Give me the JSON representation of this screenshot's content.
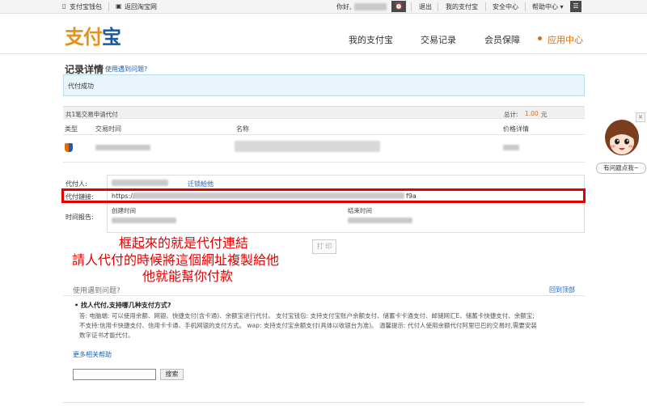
{
  "topbar": {
    "wallet": "支付宝钱包",
    "back_taobao": "返回淘宝网",
    "greeting": "你好,",
    "logout": "退出",
    "my_alipay": "我的支付宝",
    "security": "安全中心",
    "help_center": "帮助中心 ▾"
  },
  "header": {
    "logo_part1": "支付",
    "logo_part2": "宝",
    "nav": [
      "我的支付宝",
      "交易记录",
      "会员保障",
      "应用中心"
    ]
  },
  "page": {
    "title": "记录详情",
    "help_link": "使用遇到问题?",
    "status": "代付成功"
  },
  "summary": {
    "count_text": "共1笔交易申请代付",
    "total_label": "总计:",
    "total_amount": "1.00",
    "currency": "元"
  },
  "table": {
    "headers": [
      "类型",
      "交易时间",
      "名称",
      "价格详情"
    ]
  },
  "details": {
    "payer_label": "代付人:",
    "link_label": "代付鏈接:",
    "link_prefix": "https://",
    "link_suffix": "f9a",
    "extra_link": "迁锁給他",
    "time_label": "时间报告:",
    "created_time": "创建时间",
    "end_time": "结束时间"
  },
  "annotation": {
    "line1": "框起來的就是代付連結",
    "line2": "請人代付的時候將這個網址複製給他",
    "line3": "他就能幫你付款"
  },
  "print_button": "打 印",
  "help": {
    "section_title": "使用遇到问题?",
    "back_to_top": "回到顶部",
    "question": "• 找人代付,支持哪几种支付方式?",
    "answer_lines": [
      "答: 电脑端: 可以使用余额、网银、快捷支付(含卡通)、余额宝进行代付。 支付宝钱包: 支持支付宝账户余额支付、储蓄卡卡通支付、邮储网汇E、储蓄卡快捷支付、余额宝;",
      "不支持:信用卡快捷支付、信用卡卡通、手机网银的支付方式。 wap: 支持支付宝余额支付(具体以收银台为准)。 温馨提示: 代付人使用余额代付阿里巴巴的交易时,需要安装",
      "数字证书才能代付。"
    ],
    "more_help": "更多相关帮助",
    "search_button": "搜索"
  },
  "side_widget": {
    "close": "×",
    "label": "有问题点我~"
  }
}
